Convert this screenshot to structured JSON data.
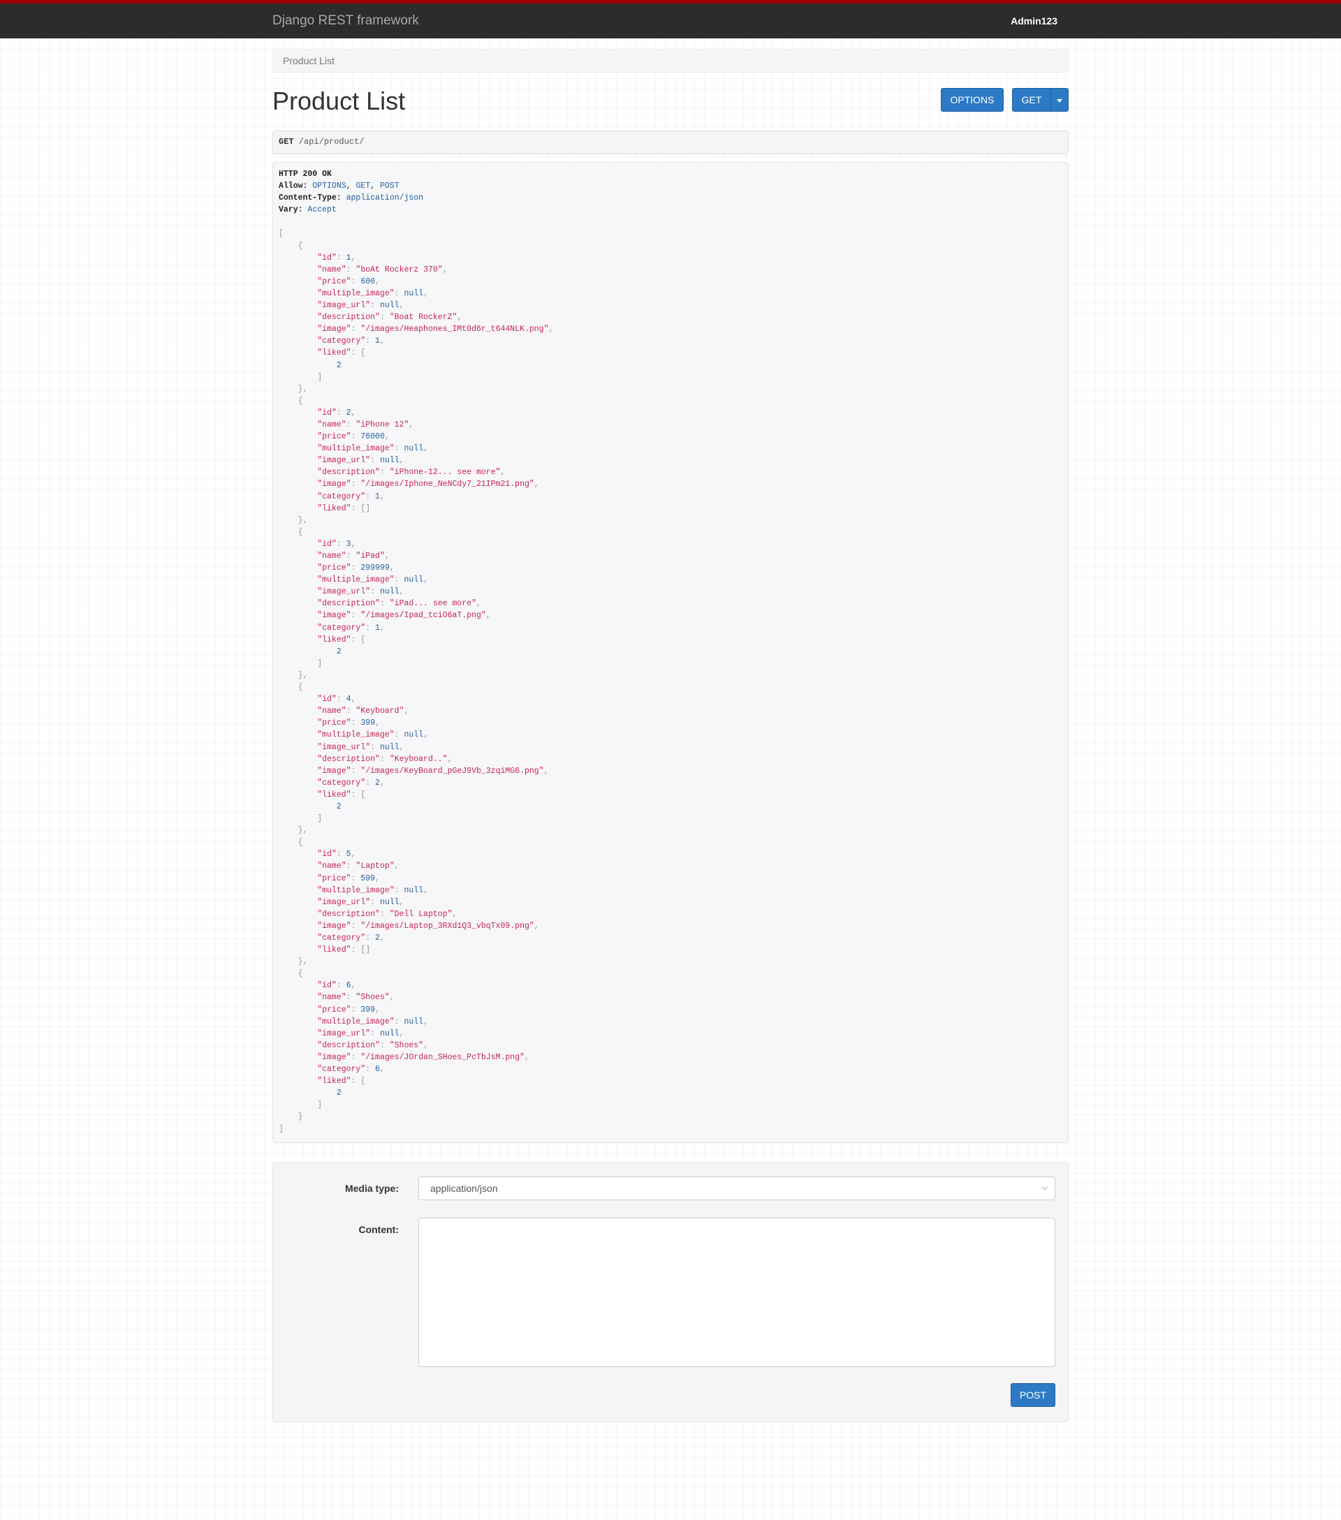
{
  "navbar": {
    "brand": "Django REST framework",
    "user": "Admin123"
  },
  "breadcrumb": {
    "item": "Product List"
  },
  "page": {
    "title": "Product List",
    "options_label": "OPTIONS",
    "get_label": "GET"
  },
  "request": {
    "method": "GET",
    "path": "/api/product/"
  },
  "response": {
    "status": "HTTP 200 OK",
    "headers": [
      {
        "key": "Allow",
        "value": "OPTIONS, GET, POST"
      },
      {
        "key": "Content-Type",
        "value": "application/json"
      },
      {
        "key": "Vary",
        "value": "Accept"
      }
    ],
    "products": [
      {
        "id": 1,
        "name": "boAt Rockerz 370",
        "price": 600,
        "multiple_image": null,
        "image_url": null,
        "description": "Boat RockerZ",
        "image": "/images/Heaphones_IMt0d6r_t644NLK.png",
        "category": 1,
        "liked": [
          2
        ]
      },
      {
        "id": 2,
        "name": "iPhone 12",
        "price": 76000,
        "multiple_image": null,
        "image_url": null,
        "description": "iPhone-12... see more",
        "image": "/images/Iphone_NeNCdy7_21IPm21.png",
        "category": 1,
        "liked": []
      },
      {
        "id": 3,
        "name": "iPad",
        "price": 299999,
        "multiple_image": null,
        "image_url": null,
        "description": "iPad... see more",
        "image": "/images/Ipad_tciO6aT.png",
        "category": 1,
        "liked": [
          2
        ]
      },
      {
        "id": 4,
        "name": "Keyboard",
        "price": 399,
        "multiple_image": null,
        "image_url": null,
        "description": "Keyboard..",
        "image": "/images/KeyBoard_pGeJ9Vb_3zqiMG6.png",
        "category": 2,
        "liked": [
          2
        ]
      },
      {
        "id": 5,
        "name": "Laptop",
        "price": 599,
        "multiple_image": null,
        "image_url": null,
        "description": "Dell Laptop",
        "image": "/images/Laptop_3RXd1Q3_vbqTx09.png",
        "category": 2,
        "liked": []
      },
      {
        "id": 6,
        "name": "Shoes",
        "price": 399,
        "multiple_image": null,
        "image_url": null,
        "description": "Shoes",
        "image": "/images/JOrdan_SHoes_PcTbJsM.png",
        "category": 6,
        "liked": [
          2
        ]
      }
    ]
  },
  "form": {
    "media_type_label": "Media type:",
    "media_type_value": "application/json",
    "content_label": "Content:",
    "content_value": "",
    "post_label": "POST"
  },
  "colors": {
    "topbar": "#2c2c2c",
    "topbar_accent": "#a30000",
    "button": "#2c7ac5",
    "json_key": "#c7254e",
    "json_value": "#1f5f9e"
  }
}
